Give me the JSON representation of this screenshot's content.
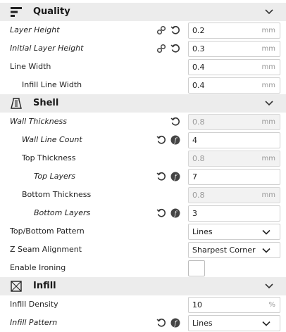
{
  "sections": {
    "quality": {
      "title": "Quality",
      "icon": "quality-icon"
    },
    "shell": {
      "title": "Shell",
      "icon": "shell-icon"
    },
    "infill": {
      "title": "Infill",
      "icon": "infill-icon"
    }
  },
  "settings": {
    "layer_height": {
      "label": "Layer Height",
      "value": "0.2",
      "unit": "mm"
    },
    "initial_layer_height": {
      "label": "Initial Layer Height",
      "value": "0.3",
      "unit": "mm"
    },
    "line_width": {
      "label": "Line Width",
      "value": "0.4",
      "unit": "mm"
    },
    "infill_line_width": {
      "label": "Infill Line Width",
      "value": "0.4",
      "unit": "mm"
    },
    "wall_thickness": {
      "label": "Wall Thickness",
      "value": "0.8",
      "unit": "mm"
    },
    "wall_line_count": {
      "label": "Wall Line Count",
      "value": "4"
    },
    "top_thickness": {
      "label": "Top Thickness",
      "value": "0.8",
      "unit": "mm"
    },
    "top_layers": {
      "label": "Top Layers",
      "value": "7"
    },
    "bottom_thickness": {
      "label": "Bottom Thickness",
      "value": "0.8",
      "unit": "mm"
    },
    "bottom_layers": {
      "label": "Bottom Layers",
      "value": "3"
    },
    "top_bottom_pattern": {
      "label": "Top/Bottom Pattern",
      "value": "Lines"
    },
    "z_seam_alignment": {
      "label": "Z Seam Alignment",
      "value": "Sharpest Corner"
    },
    "enable_ironing": {
      "label": "Enable Ironing",
      "checked": false
    },
    "infill_density": {
      "label": "Infill Density",
      "value": "10",
      "unit": "%"
    },
    "infill_pattern": {
      "label": "Infill Pattern",
      "value": "Lines"
    }
  }
}
